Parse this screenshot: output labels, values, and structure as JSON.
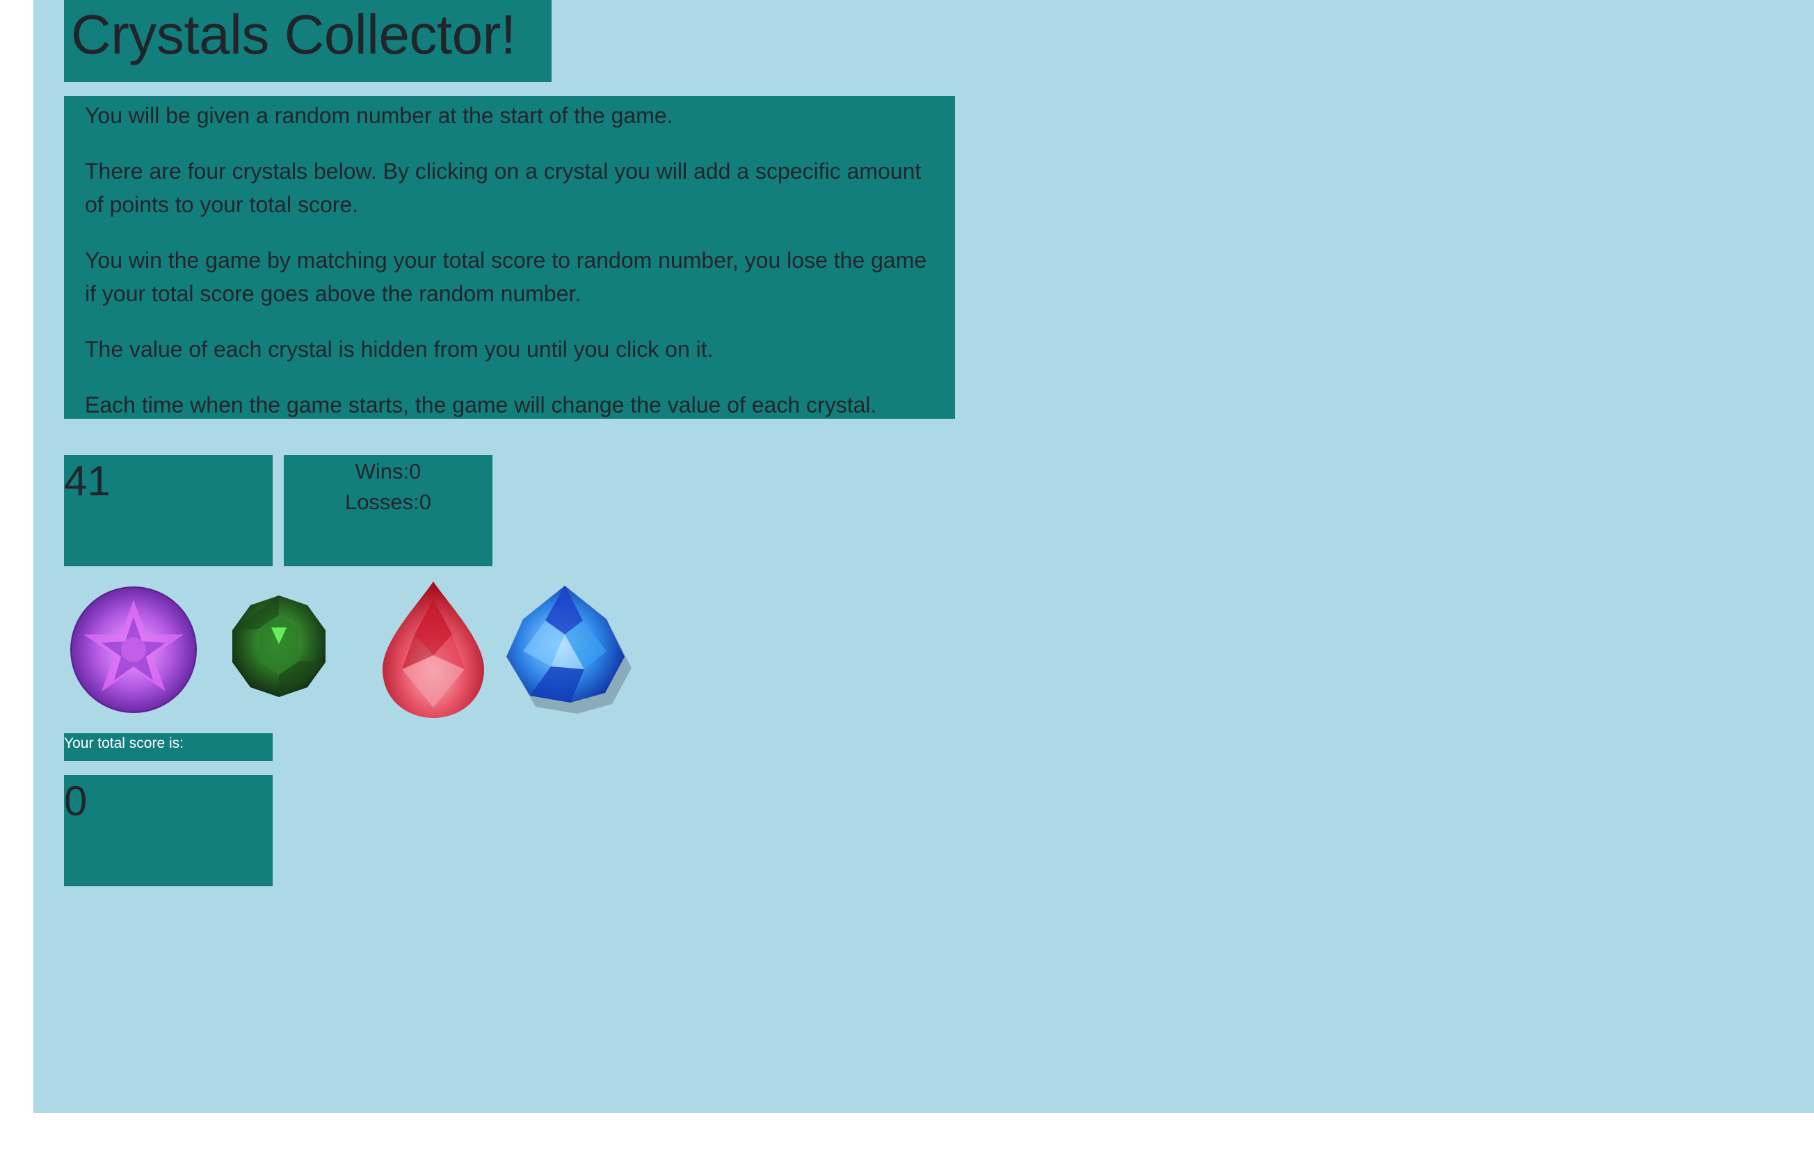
{
  "header": {
    "title": "Crystals Collector!"
  },
  "instructions": {
    "paragraphs": [
      "You will be given a random number at the start of the game.",
      "There are four crystals below. By clicking on a crystal you will add a scpecific amount of points to your total score.",
      "You win the game by matching your total score to random number, you lose the game if your total score goes above the random number.",
      "The value of each crystal is hidden from you until you click on it.",
      "Each time when the game starts, the game will change the value of each crystal."
    ]
  },
  "game": {
    "random_number": "41",
    "wins_label": "Wins:0",
    "losses_label": "Losses:0",
    "score_label": "Your total score is:",
    "total_score": "0"
  },
  "crystals": [
    {
      "icon": "purple-round-gem-icon",
      "color": "#b05ae0"
    },
    {
      "icon": "green-round-gem-icon",
      "color": "#2f7a2a"
    },
    {
      "icon": "red-pear-gem-icon",
      "color": "#e0404e"
    },
    {
      "icon": "blue-trillion-gem-icon",
      "color": "#2d6fe0"
    }
  ],
  "colors": {
    "page_background": "#add8e6",
    "panel": "#137f7d",
    "text": "#212529"
  }
}
